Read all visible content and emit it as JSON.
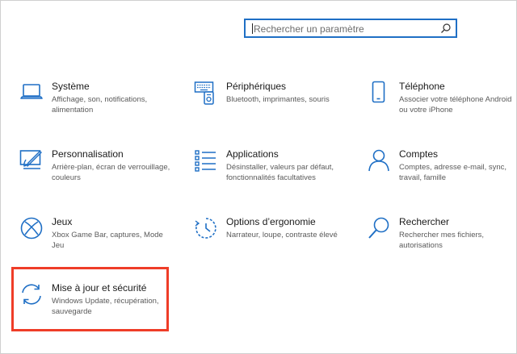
{
  "search": {
    "placeholder": "Rechercher un paramètre",
    "icon": "search-icon"
  },
  "accent_color": "#1f6fc5",
  "highlight_color": "#ef3d28",
  "tiles": [
    {
      "title": "Système",
      "desc": "Affichage, son, notifications, alimentation",
      "icon": "laptop-icon"
    },
    {
      "title": "Périphériques",
      "desc": "Bluetooth, imprimantes, souris",
      "icon": "devices-icon"
    },
    {
      "title": "Téléphone",
      "desc": "Associer votre téléphone Android ou votre iPhone",
      "icon": "phone-icon"
    },
    {
      "title": "Personnalisation",
      "desc": "Arrière-plan, écran de verrouillage, couleurs",
      "icon": "personalization-icon"
    },
    {
      "title": "Applications",
      "desc": "Désinstaller, valeurs par défaut, fonctionnalités facultatives",
      "icon": "apps-list-icon"
    },
    {
      "title": "Comptes",
      "desc": "Comptes, adresse e-mail, sync, travail, famille",
      "icon": "person-icon"
    },
    {
      "title": "Jeux",
      "desc": "Xbox Game Bar, captures, Mode Jeu",
      "icon": "xbox-icon"
    },
    {
      "title": "Options d’ergonomie",
      "desc": "Narrateur, loupe, contraste élevé",
      "icon": "ease-of-access-icon"
    },
    {
      "title": "Rechercher",
      "desc": "Rechercher mes fichiers, autorisations",
      "icon": "magnifier-icon"
    },
    {
      "title": "Mise à jour et sécurité",
      "desc": "Windows Update, récupération, sauvegarde",
      "icon": "update-sync-icon"
    }
  ]
}
